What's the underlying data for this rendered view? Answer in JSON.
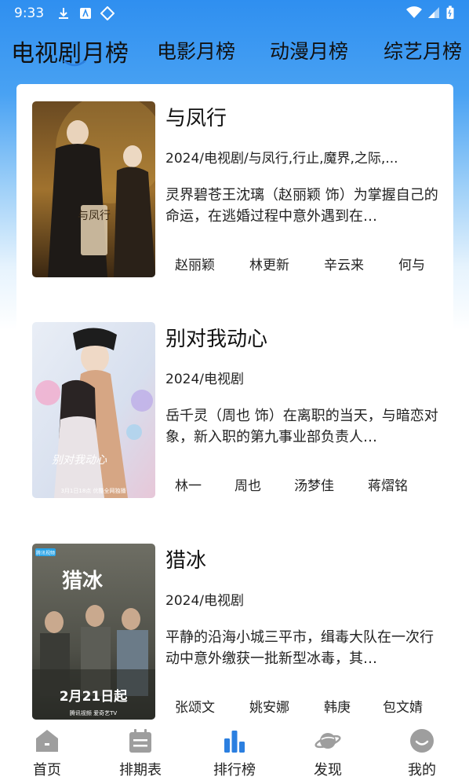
{
  "status_bar": {
    "time": "9:33"
  },
  "tabs": [
    {
      "label": "电视剧月榜",
      "active": true
    },
    {
      "label": "电影月榜",
      "active": false
    },
    {
      "label": "动漫月榜",
      "active": false
    },
    {
      "label": "综艺月榜",
      "active": false
    }
  ],
  "items": [
    {
      "title": "与凤行",
      "meta": "2024/电视剧/与凤行,行止,魔界,之际,...",
      "desc": "灵界碧苍王沈璃（赵丽颖 饰）为掌握自己的命运，在逃婚过程中意外遇到在…",
      "actors": [
        "赵丽颖",
        "林更新",
        "辛云来",
        "何与"
      ]
    },
    {
      "title": "别对我动心",
      "meta": "2024/电视剧",
      "desc": "岳千灵（周也 饰）在离职的当天，与暗恋对象，新入职的第九事业部负责人…",
      "actors": [
        "林一",
        "周也",
        "汤梦佳",
        "蒋熠铭"
      ]
    },
    {
      "title": "猎冰",
      "meta": "2024/电视剧",
      "desc": "平静的沿海小城三平市，缉毒大队在一次行动中意外缴获一批新型冰毒，其…",
      "actors": [
        "张颂文",
        "姚安娜",
        "韩庚",
        "包文婧"
      ]
    }
  ],
  "posters": [
    {
      "text": "与凤行"
    },
    {
      "text": "别对我动心",
      "footer": "3月1日18点 优酷全网独播"
    },
    {
      "text": "猎冰",
      "badge": "腾讯视频",
      "date": "2月21日起",
      "footer": "腾讯视频  爱奇艺TV"
    }
  ],
  "bottom_nav": [
    {
      "label": "首页",
      "icon": "home-icon"
    },
    {
      "label": "排期表",
      "icon": "calendar-icon"
    },
    {
      "label": "排行榜",
      "icon": "ranking-icon",
      "active": true
    },
    {
      "label": "发现",
      "icon": "planet-icon"
    },
    {
      "label": "我的",
      "icon": "profile-icon"
    }
  ],
  "colors": {
    "accent": "#2b7fe0",
    "nav_icon": "#9e9e9e",
    "header_blue": "#2f8ff0"
  }
}
